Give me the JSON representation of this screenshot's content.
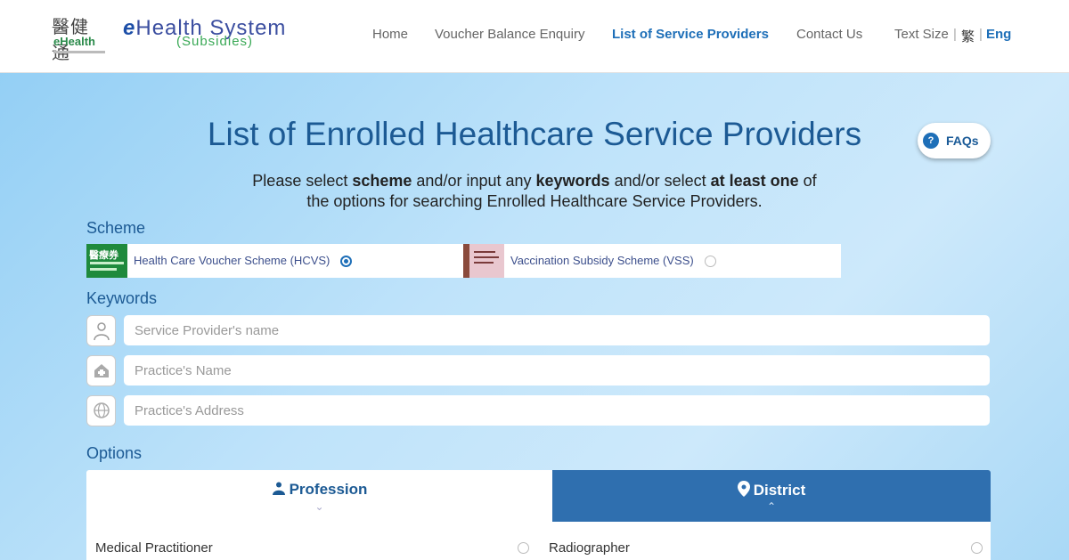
{
  "header": {
    "logo_cn": "醫健通",
    "logo_en": "eHealth",
    "system_title": "Health System",
    "system_title_prefix": "e",
    "system_subtitle": "(Subsidies)",
    "nav": [
      {
        "label": "Home",
        "active": false
      },
      {
        "label": "Voucher Balance Enquiry",
        "active": false
      },
      {
        "label": "List of Service Providers",
        "active": true
      },
      {
        "label": "Contact Us",
        "active": false
      }
    ],
    "text_size_label": "Text Size",
    "lang_separator": "|",
    "lang_tc": "繁",
    "lang_en": "Eng"
  },
  "main": {
    "title": "List of Enrolled Healthcare Service Providers",
    "faq_icon": "?",
    "faq_label": "FAQs",
    "instruction": {
      "t1": "Please select ",
      "b1": "scheme",
      "t2": " and/or input any ",
      "b2": "keywords",
      "t3": " and/or select ",
      "b3": "at least one",
      "t4": " of",
      "line2": "the options for searching Enrolled Healthcare Service Providers."
    },
    "scheme_label": "Scheme",
    "schemes": [
      {
        "name": "Health Care Voucher Scheme (HCVS)",
        "selected": true,
        "badge": "醫療券"
      },
      {
        "name": "Vaccination Subsidy Scheme (VSS)",
        "selected": false
      }
    ],
    "keywords_label": "Keywords",
    "keywords": [
      {
        "placeholder": "Service Provider's name",
        "value": "",
        "icon": "doctor-icon"
      },
      {
        "placeholder": "Practice's Name",
        "value": "",
        "icon": "clinic-icon"
      },
      {
        "placeholder": "Practice's Address",
        "value": "",
        "icon": "globe-icon"
      }
    ],
    "options_label": "Options",
    "tabs": [
      {
        "label": "Profession",
        "icon": "doctor-icon",
        "active": true
      },
      {
        "label": "District",
        "icon": "map-pin-icon",
        "active": false
      }
    ],
    "profession_options": [
      "Medical Practitioner",
      "Radiographer"
    ]
  },
  "colors": {
    "accent": "#1e6fb8",
    "title": "#1c5a94",
    "tab_active_bg": "#2f6faf",
    "hcvs_green": "#1f8a3c"
  }
}
